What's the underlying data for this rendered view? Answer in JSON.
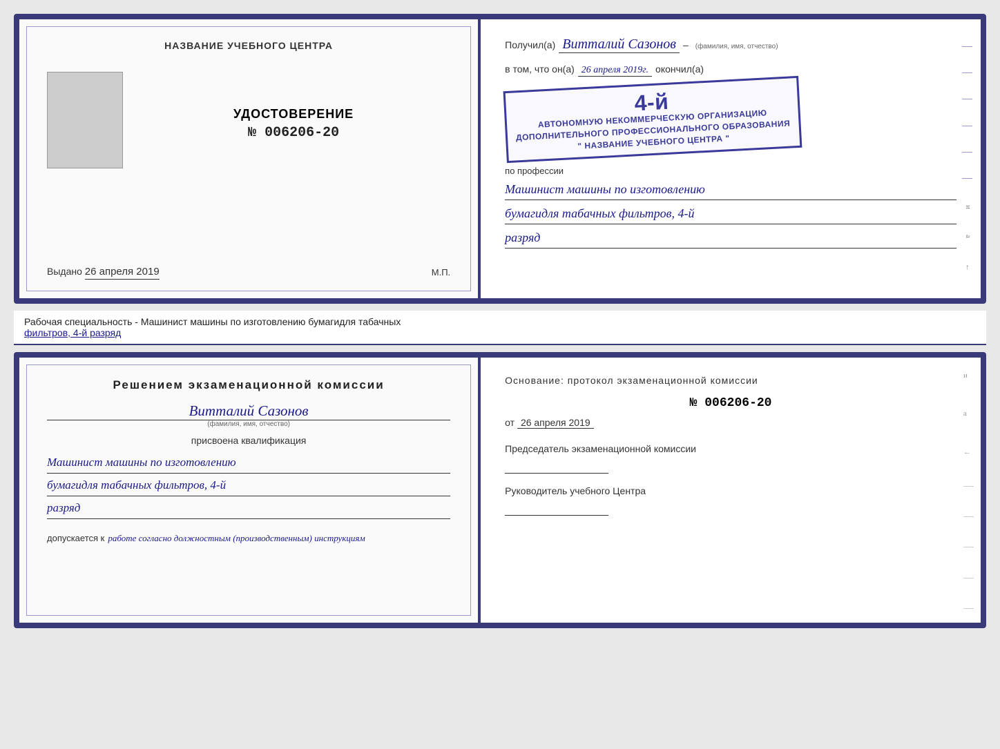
{
  "top_cert": {
    "left": {
      "title": "НАЗВАНИЕ УЧЕБНОГО ЦЕНТРА",
      "udost_title": "УДОСТОВЕРЕНИЕ",
      "udost_number": "№ 006206-20",
      "vydano_label": "Выдано",
      "vydano_date": "26 апреля 2019",
      "mp_label": "М.П."
    },
    "right": {
      "poluchil_prefix": "Получил(а)",
      "name_handwritten": "Витталий Сазонов",
      "name_hint": "(фамилия, имя, отчество)",
      "dash": "–",
      "vtom_prefix": "в том, что он(а)",
      "date_handwritten": "26 апреля 2019г.",
      "okonchil": "окончил(а)",
      "stamp_line1": "АВТОНОМНУЮ НЕКОММЕРЧЕСКУЮ ОРГАНИЗАЦИЮ",
      "stamp_line2": "ДОПОЛНИТЕЛЬНОГО ПРОФЕССИОНАЛЬНОГО ОБРАЗОВАНИЯ",
      "stamp_line3": "\" НАЗВАНИЕ УЧЕБНОГО ЦЕНТРА \"",
      "stamp_number": "4-й",
      "po_professii": "по профессии",
      "profession_line1": "Машинист машины по изготовлению",
      "profession_line2": "бумагидля табачных фильтров, 4-й",
      "profession_line3": "разряд"
    }
  },
  "middle": {
    "text_prefix": "Рабочая специальность - Машинист машины по изготовлению бумагидля табачных",
    "text_underline": "фильтров, 4-й разряд"
  },
  "bottom_cert": {
    "left": {
      "komissia_title": "Решением  экзаменационной  комиссии",
      "name_handwritten": "Витталий Сазонов",
      "name_hint": "(фамилия, имя, отчество)",
      "prisvoena": "присвоена квалификация",
      "prof_line1": "Машинист машины по изготовлению",
      "prof_line2": "бумагидля табачных фильтров, 4-й",
      "prof_line3": "разряд",
      "dopuskaetsya_label": "допускается к",
      "dopuskaetsya_text": "работе согласно должностным (производственным) инструкциям"
    },
    "right": {
      "osnovanie_title": "Основание: протокол экзаменационной  комиссии",
      "proto_number": "№  006206-20",
      "ot_prefix": "от",
      "ot_date": "26 апреля 2019",
      "predsedatel_label": "Председатель экзаменационной комиссии",
      "rukovoditel_label": "Руководитель учебного Центра"
    }
  }
}
